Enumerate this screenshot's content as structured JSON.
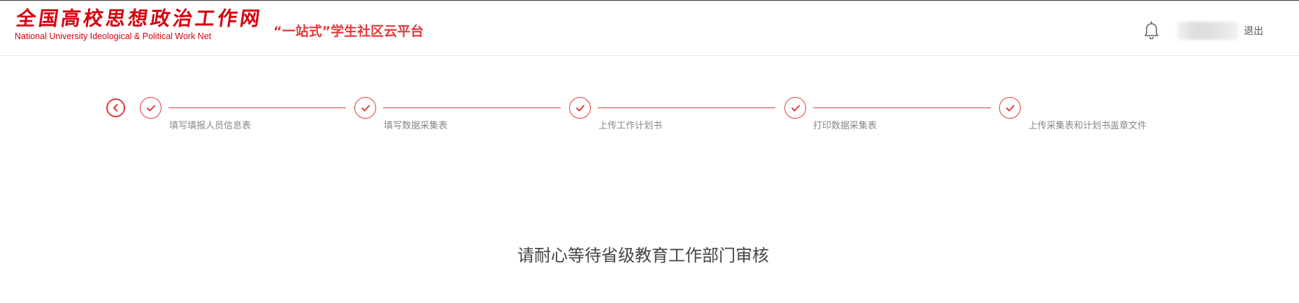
{
  "header": {
    "logo_cn": "全国高校思想政治工作网",
    "logo_en": "National University Ideological & Political Work Net",
    "platform_title": "“一站式”学生社区云平台",
    "logout_label": "退出"
  },
  "icons": {
    "bell": "bell-icon",
    "back": "chevron-left-icon",
    "step_done": "check-icon"
  },
  "colors": {
    "brand_red": "#d7000f",
    "accent_red": "#e4393c"
  },
  "steps": [
    {
      "label": "填写填报人员信息表",
      "status": "done"
    },
    {
      "label": "填写数据采集表",
      "status": "done"
    },
    {
      "label": "上传工作计划书",
      "status": "done"
    },
    {
      "label": "打印数据采集表",
      "status": "done"
    },
    {
      "label": "上传采集表和计划书盖章文件",
      "status": "done"
    }
  ],
  "main": {
    "message": "请耐心等待省级教育工作部门审核"
  }
}
